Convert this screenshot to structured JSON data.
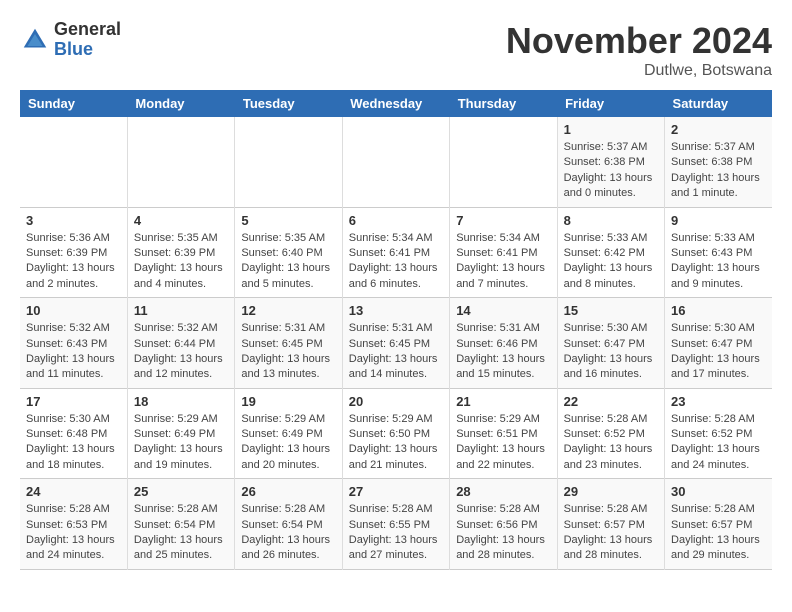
{
  "logo": {
    "general": "General",
    "blue": "Blue"
  },
  "header": {
    "month": "November 2024",
    "location": "Dutlwe, Botswana"
  },
  "weekdays": [
    "Sunday",
    "Monday",
    "Tuesday",
    "Wednesday",
    "Thursday",
    "Friday",
    "Saturday"
  ],
  "weeks": [
    [
      {
        "day": "",
        "info": ""
      },
      {
        "day": "",
        "info": ""
      },
      {
        "day": "",
        "info": ""
      },
      {
        "day": "",
        "info": ""
      },
      {
        "day": "",
        "info": ""
      },
      {
        "day": "1",
        "info": "Sunrise: 5:37 AM\nSunset: 6:38 PM\nDaylight: 13 hours and 0 minutes."
      },
      {
        "day": "2",
        "info": "Sunrise: 5:37 AM\nSunset: 6:38 PM\nDaylight: 13 hours and 1 minute."
      }
    ],
    [
      {
        "day": "3",
        "info": "Sunrise: 5:36 AM\nSunset: 6:39 PM\nDaylight: 13 hours and 2 minutes."
      },
      {
        "day": "4",
        "info": "Sunrise: 5:35 AM\nSunset: 6:39 PM\nDaylight: 13 hours and 4 minutes."
      },
      {
        "day": "5",
        "info": "Sunrise: 5:35 AM\nSunset: 6:40 PM\nDaylight: 13 hours and 5 minutes."
      },
      {
        "day": "6",
        "info": "Sunrise: 5:34 AM\nSunset: 6:41 PM\nDaylight: 13 hours and 6 minutes."
      },
      {
        "day": "7",
        "info": "Sunrise: 5:34 AM\nSunset: 6:41 PM\nDaylight: 13 hours and 7 minutes."
      },
      {
        "day": "8",
        "info": "Sunrise: 5:33 AM\nSunset: 6:42 PM\nDaylight: 13 hours and 8 minutes."
      },
      {
        "day": "9",
        "info": "Sunrise: 5:33 AM\nSunset: 6:43 PM\nDaylight: 13 hours and 9 minutes."
      }
    ],
    [
      {
        "day": "10",
        "info": "Sunrise: 5:32 AM\nSunset: 6:43 PM\nDaylight: 13 hours and 11 minutes."
      },
      {
        "day": "11",
        "info": "Sunrise: 5:32 AM\nSunset: 6:44 PM\nDaylight: 13 hours and 12 minutes."
      },
      {
        "day": "12",
        "info": "Sunrise: 5:31 AM\nSunset: 6:45 PM\nDaylight: 13 hours and 13 minutes."
      },
      {
        "day": "13",
        "info": "Sunrise: 5:31 AM\nSunset: 6:45 PM\nDaylight: 13 hours and 14 minutes."
      },
      {
        "day": "14",
        "info": "Sunrise: 5:31 AM\nSunset: 6:46 PM\nDaylight: 13 hours and 15 minutes."
      },
      {
        "day": "15",
        "info": "Sunrise: 5:30 AM\nSunset: 6:47 PM\nDaylight: 13 hours and 16 minutes."
      },
      {
        "day": "16",
        "info": "Sunrise: 5:30 AM\nSunset: 6:47 PM\nDaylight: 13 hours and 17 minutes."
      }
    ],
    [
      {
        "day": "17",
        "info": "Sunrise: 5:30 AM\nSunset: 6:48 PM\nDaylight: 13 hours and 18 minutes."
      },
      {
        "day": "18",
        "info": "Sunrise: 5:29 AM\nSunset: 6:49 PM\nDaylight: 13 hours and 19 minutes."
      },
      {
        "day": "19",
        "info": "Sunrise: 5:29 AM\nSunset: 6:49 PM\nDaylight: 13 hours and 20 minutes."
      },
      {
        "day": "20",
        "info": "Sunrise: 5:29 AM\nSunset: 6:50 PM\nDaylight: 13 hours and 21 minutes."
      },
      {
        "day": "21",
        "info": "Sunrise: 5:29 AM\nSunset: 6:51 PM\nDaylight: 13 hours and 22 minutes."
      },
      {
        "day": "22",
        "info": "Sunrise: 5:28 AM\nSunset: 6:52 PM\nDaylight: 13 hours and 23 minutes."
      },
      {
        "day": "23",
        "info": "Sunrise: 5:28 AM\nSunset: 6:52 PM\nDaylight: 13 hours and 24 minutes."
      }
    ],
    [
      {
        "day": "24",
        "info": "Sunrise: 5:28 AM\nSunset: 6:53 PM\nDaylight: 13 hours and 24 minutes."
      },
      {
        "day": "25",
        "info": "Sunrise: 5:28 AM\nSunset: 6:54 PM\nDaylight: 13 hours and 25 minutes."
      },
      {
        "day": "26",
        "info": "Sunrise: 5:28 AM\nSunset: 6:54 PM\nDaylight: 13 hours and 26 minutes."
      },
      {
        "day": "27",
        "info": "Sunrise: 5:28 AM\nSunset: 6:55 PM\nDaylight: 13 hours and 27 minutes."
      },
      {
        "day": "28",
        "info": "Sunrise: 5:28 AM\nSunset: 6:56 PM\nDaylight: 13 hours and 28 minutes."
      },
      {
        "day": "29",
        "info": "Sunrise: 5:28 AM\nSunset: 6:57 PM\nDaylight: 13 hours and 28 minutes."
      },
      {
        "day": "30",
        "info": "Sunrise: 5:28 AM\nSunset: 6:57 PM\nDaylight: 13 hours and 29 minutes."
      }
    ]
  ]
}
